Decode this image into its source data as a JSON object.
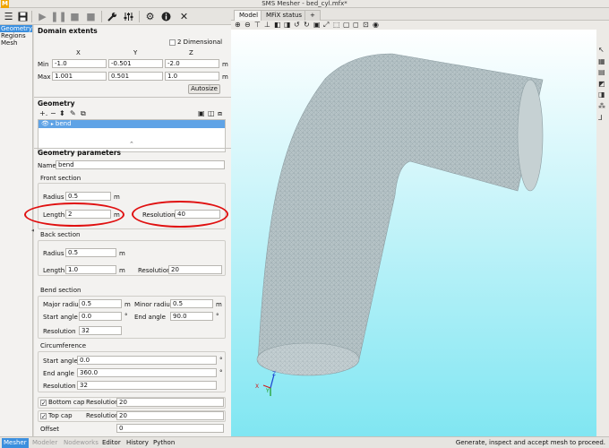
{
  "window": {
    "title": "SMS Mesher - bed_cyl.mfx*"
  },
  "app_logo": "M",
  "nav": {
    "items": [
      "Geometry",
      "Regions",
      "Mesh"
    ],
    "selected": "Geometry"
  },
  "domain_extents": {
    "title": "Domain extents",
    "two_dimensional_label": "2 Dimensional",
    "axes": [
      "X",
      "Y",
      "Z"
    ],
    "min_label": "Min",
    "max_label": "Max",
    "unit": "m",
    "min": [
      "-1.0",
      "-0.501",
      "-2.0"
    ],
    "max": [
      "1.001",
      "0.501",
      "1.0"
    ],
    "autosize_label": "Autosize"
  },
  "geometry": {
    "title": "Geometry",
    "items": [
      {
        "name": "bend",
        "visible": true
      }
    ]
  },
  "params": {
    "title": "Geometry parameters",
    "name_label": "Name",
    "name_value": "bend",
    "front": {
      "title": "Front section",
      "radius_label": "Radius",
      "radius": "0.5",
      "radius_unit": "m",
      "length_label": "Length",
      "length": "2",
      "length_unit": "m",
      "resolution_label": "Resolution",
      "resolution": "40"
    },
    "back": {
      "title": "Back section",
      "radius_label": "Radius",
      "radius": "0.5",
      "radius_unit": "m",
      "length_label": "Length",
      "length": "1.0",
      "length_unit": "m",
      "resolution_label": "Resolution",
      "resolution": "20"
    },
    "bend": {
      "title": "Bend section",
      "major_radius_label": "Major radius",
      "major_radius": "0.5",
      "major_unit": "m",
      "minor_radius_label": "Minor radius",
      "minor_radius": "0.5",
      "minor_unit": "m",
      "start_angle_label": "Start angle",
      "start_angle": "0.0",
      "start_unit": "°",
      "end_angle_label": "End angle",
      "end_angle": "90.0",
      "end_unit": "°",
      "resolution_label": "Resolution",
      "resolution": "32"
    },
    "circumference": {
      "title": "Circumference",
      "start_angle_label": "Start angle",
      "start_angle": "0.0",
      "start_unit": "°",
      "end_angle_label": "End angle",
      "end_angle": "360.0",
      "end_unit": "°",
      "resolution_label": "Resolution",
      "resolution": "32"
    },
    "bottom_cap": {
      "label": "Bottom cap",
      "checked": true,
      "resolution_label": "Resolution",
      "resolution": "20"
    },
    "top_cap": {
      "label": "Top cap",
      "checked": true,
      "resolution_label": "Resolution",
      "resolution": "20"
    },
    "offset_label": "Offset",
    "offset": "0"
  },
  "tabs": [
    {
      "label": "Model",
      "active": true
    },
    {
      "label": "MFiX status",
      "active": false
    },
    {
      "label": "+",
      "active": false
    }
  ],
  "axes_triad": {
    "x": "X",
    "y": "Y",
    "z": "Z"
  },
  "status_tabs": [
    {
      "label": "Mesher",
      "state": "active"
    },
    {
      "label": "Modeler",
      "state": "disabled"
    },
    {
      "label": "Nodeworks",
      "state": "disabled"
    },
    {
      "label": "Editor",
      "state": "normal"
    },
    {
      "label": "History",
      "state": "normal"
    },
    {
      "label": "Python",
      "state": "normal"
    }
  ],
  "status_message": "Generate, inspect and accept mesh to proceed.",
  "colors": {
    "accent": "#3b8fde",
    "viewport_top": "#ffffff",
    "viewport_bottom": "#80e6f2",
    "mesh": "#b6c3c6",
    "annotation": "#e01010"
  }
}
